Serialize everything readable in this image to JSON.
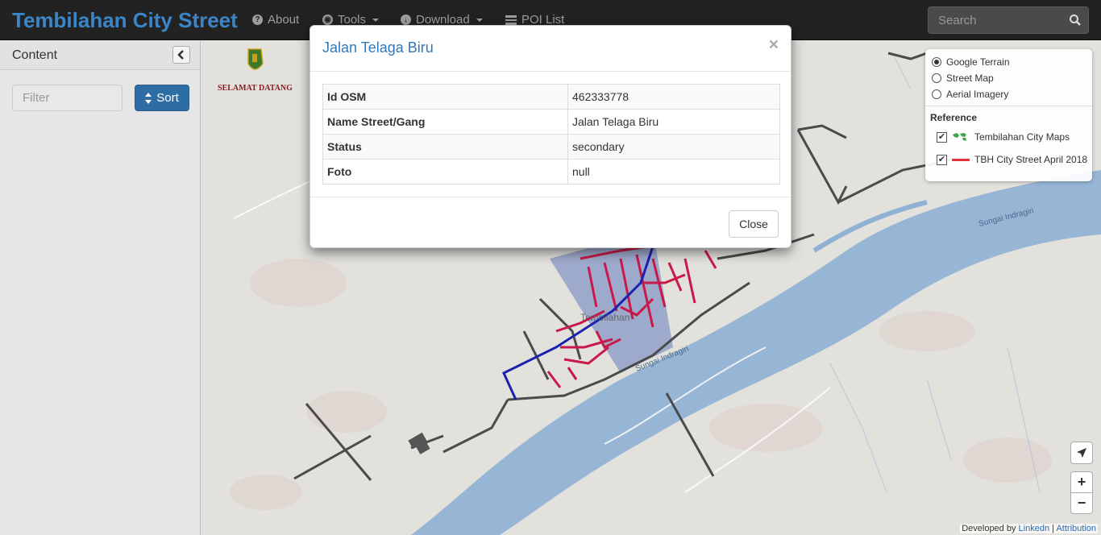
{
  "navbar": {
    "brand": "Tembilahan City Street",
    "items": [
      {
        "label": "About",
        "icon": "question-circle-icon"
      },
      {
        "label": "Tools",
        "icon": "globe-icon"
      },
      {
        "label": "Download",
        "icon": "cloud-download-icon"
      },
      {
        "label": "POI List",
        "icon": "list-icon"
      }
    ],
    "search_placeholder": "Search"
  },
  "sidebar": {
    "title": "Content",
    "filter_placeholder": "Filter",
    "sort_label": "Sort"
  },
  "map": {
    "logo_text": "SELAMAT DATANG",
    "labels": {
      "town": "Tembilahan",
      "river1": "Sungai Indragiri",
      "river2": "Sungai Indragiri"
    },
    "colors": {
      "river": "#7aa3cc",
      "street_red": "#c8194a",
      "street_dark": "#4a4a4a",
      "street_blue": "#1a22b0"
    }
  },
  "layers": {
    "base": [
      {
        "label": "Google Terrain",
        "selected": true
      },
      {
        "label": "Street Map",
        "selected": false
      },
      {
        "label": "Aerial Imagery",
        "selected": false
      }
    ],
    "reference_title": "Reference",
    "overlays": [
      {
        "label": "Tembilahan City Maps",
        "checked": true
      },
      {
        "label": "TBH City Street April 2018",
        "checked": true
      }
    ]
  },
  "controls": {
    "zoom_in": "+",
    "zoom_out": "−"
  },
  "attribution": {
    "developed_by": "Developed by",
    "linkedin": "Linkedn",
    "sep": "|",
    "attribution": "Attribution"
  },
  "modal": {
    "title": "Jalan Telaga Biru",
    "close_x": "×",
    "rows": [
      {
        "key": "Id OSM",
        "value": "462333778"
      },
      {
        "key": "Name Street/Gang",
        "value": "Jalan Telaga Biru"
      },
      {
        "key": "Status",
        "value": "secondary"
      },
      {
        "key": "Foto",
        "value": "null"
      }
    ],
    "close_label": "Close"
  }
}
